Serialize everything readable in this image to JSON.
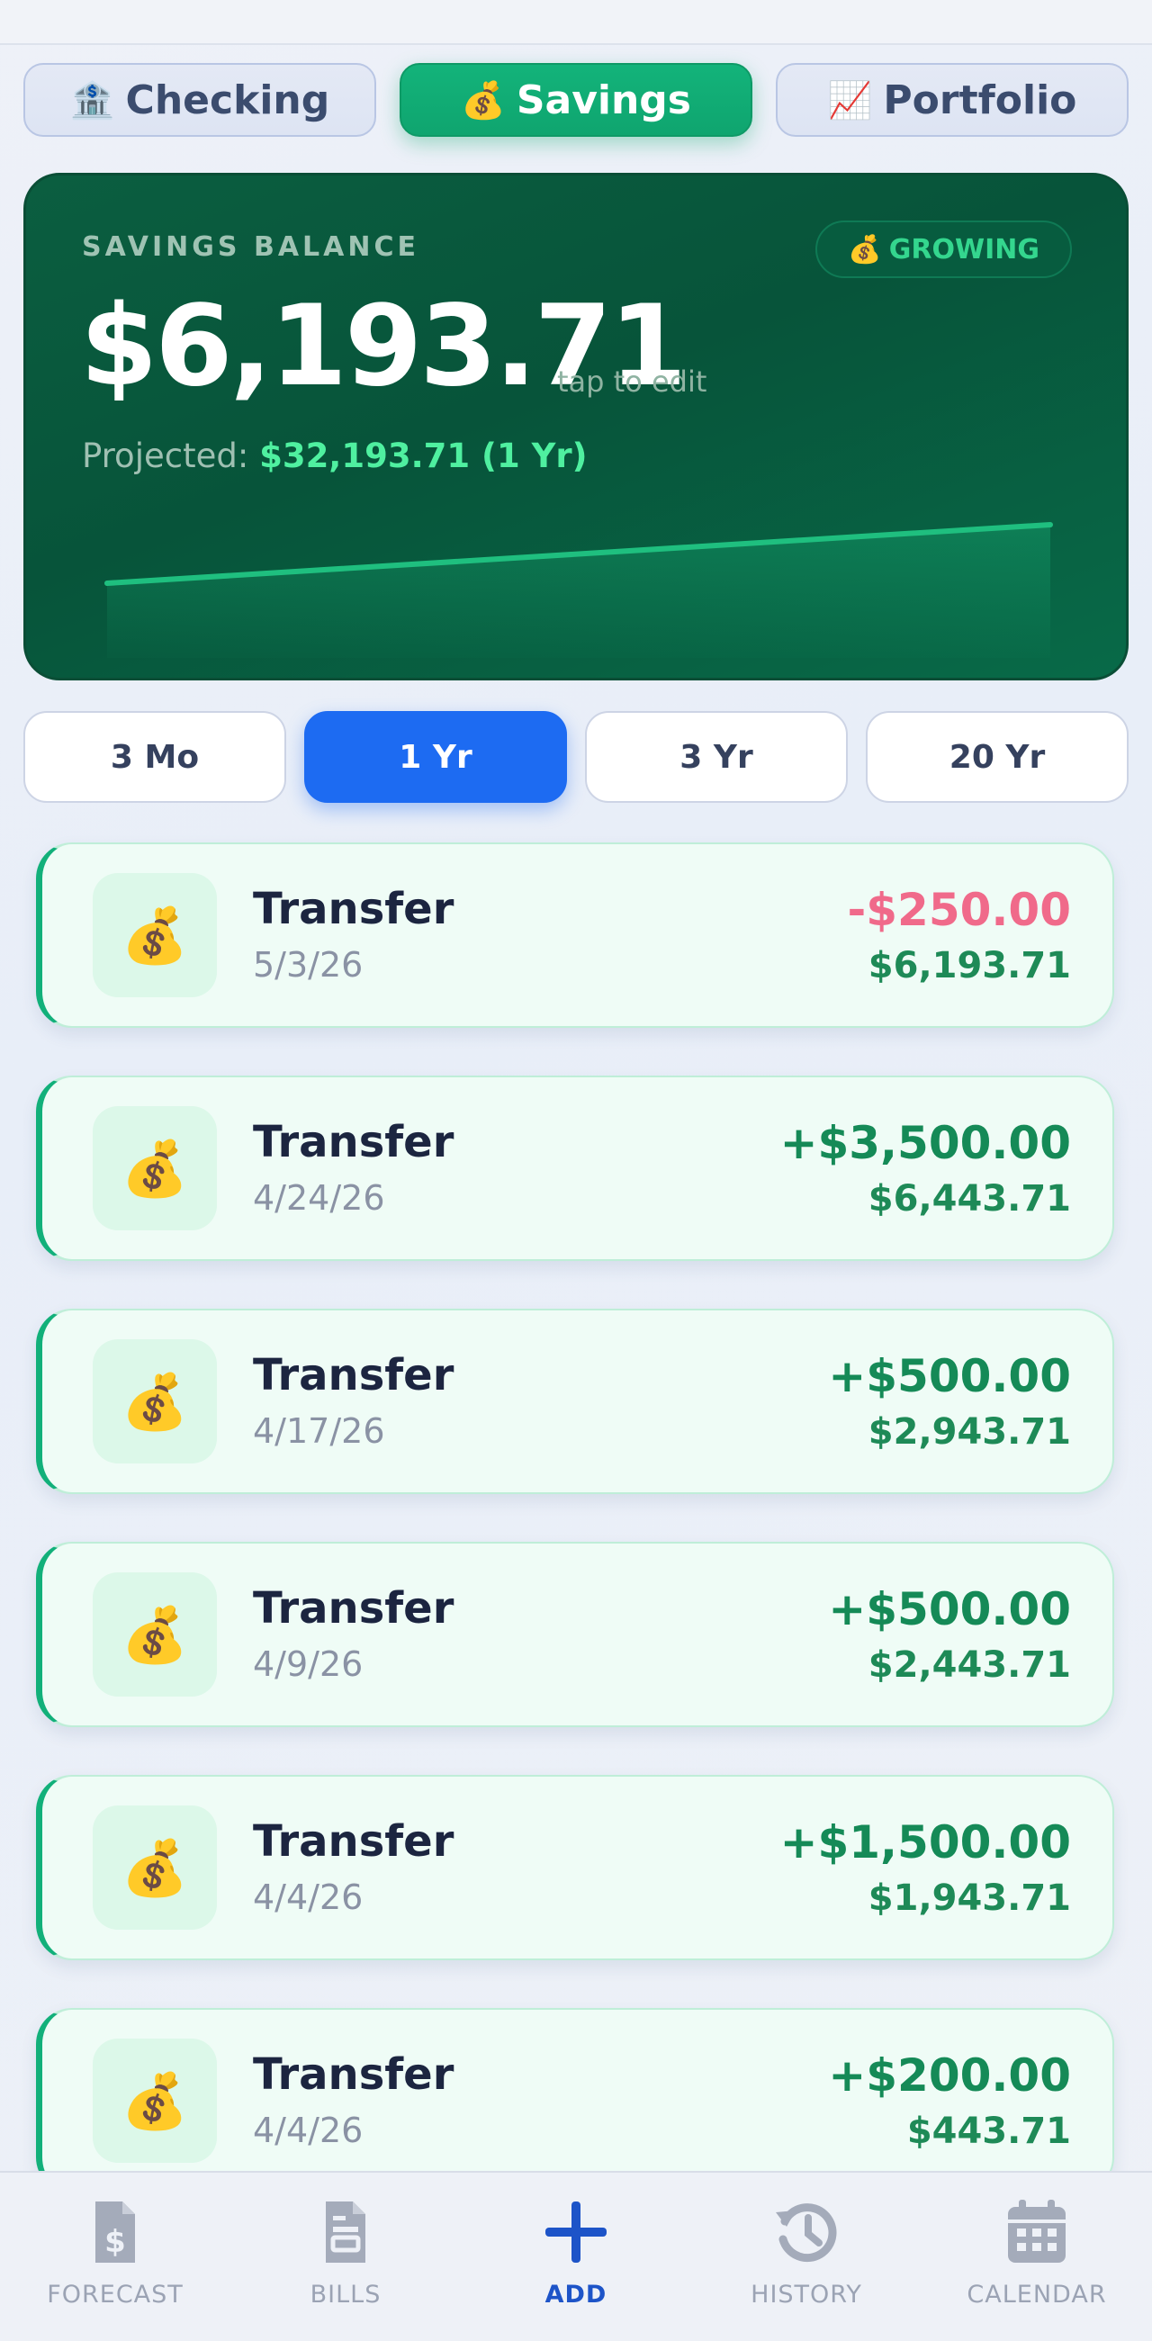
{
  "account_tabs": [
    {
      "icon": "bank-icon",
      "emoji": "🏦",
      "label": "Checking",
      "active": false
    },
    {
      "icon": "money-bag-icon",
      "emoji": "💰",
      "label": "Savings",
      "active": true
    },
    {
      "icon": "chart-up-icon",
      "emoji": "📈",
      "label": "Portfolio",
      "active": false
    }
  ],
  "balance_card": {
    "label": "SAVINGS BALANCE",
    "badge_emoji": "💰",
    "badge_text": "GROWING",
    "amount": "$6,193.71",
    "edit_hint": "tap to edit",
    "projected_label": "Projected:",
    "projected_value": "$32,193.71 (1 Yr)",
    "colors": {
      "card": "#07543a",
      "line": "#1fbf7f",
      "projected": "#4ff0a0"
    }
  },
  "ranges": [
    {
      "label": "3 Mo",
      "active": false
    },
    {
      "label": "1 Yr",
      "active": true
    },
    {
      "label": "3 Yr",
      "active": false
    },
    {
      "label": "20 Yr",
      "active": false
    }
  ],
  "transactions": [
    {
      "icon": "money-bag-icon",
      "emoji": "💰",
      "title": "Transfer",
      "date": "5/3/26",
      "amount": "-$250.00",
      "direction": "negative",
      "balance": "$6,193.71"
    },
    {
      "icon": "money-bag-icon",
      "emoji": "💰",
      "title": "Transfer",
      "date": "4/24/26",
      "amount": "+$3,500.00",
      "direction": "positive",
      "balance": "$6,443.71"
    },
    {
      "icon": "money-bag-icon",
      "emoji": "💰",
      "title": "Transfer",
      "date": "4/17/26",
      "amount": "+$500.00",
      "direction": "positive",
      "balance": "$2,943.71"
    },
    {
      "icon": "money-bag-icon",
      "emoji": "💰",
      "title": "Transfer",
      "date": "4/9/26",
      "amount": "+$500.00",
      "direction": "positive",
      "balance": "$2,443.71"
    },
    {
      "icon": "money-bag-icon",
      "emoji": "💰",
      "title": "Transfer",
      "date": "4/4/26",
      "amount": "+$1,500.00",
      "direction": "positive",
      "balance": "$1,943.71"
    },
    {
      "icon": "money-bag-icon",
      "emoji": "💰",
      "title": "Transfer",
      "date": "4/4/26",
      "amount": "+$200.00",
      "direction": "positive",
      "balance": "$443.71"
    }
  ],
  "bottom_nav": [
    {
      "icon": "invoice-icon",
      "label": "FORECAST",
      "active": false
    },
    {
      "icon": "bills-icon",
      "label": "BILLS",
      "active": false
    },
    {
      "icon": "plus-icon",
      "label": "ADD",
      "active": true
    },
    {
      "icon": "history-icon",
      "label": "HISTORY",
      "active": false
    },
    {
      "icon": "calendar-icon",
      "label": "CALENDAR",
      "active": false
    }
  ],
  "colors": {
    "accent_green": "#12b07a",
    "accent_blue": "#1d6bf2",
    "negative": "#f06a8a",
    "positive": "#158a57"
  }
}
